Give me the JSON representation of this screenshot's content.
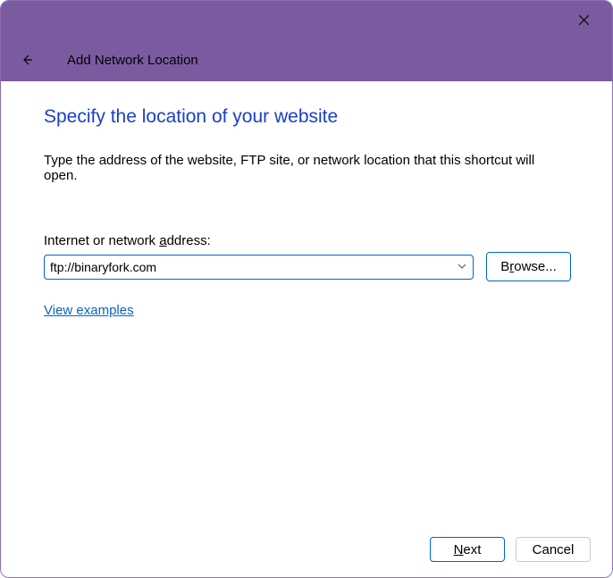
{
  "window": {
    "header_title": "Add Network Location"
  },
  "page": {
    "heading": "Specify the location of your website",
    "description": "Type the address of the website, FTP site, or network location that this shortcut will open.",
    "input_label_prefix": "Internet or network ",
    "input_label_accel": "a",
    "input_label_suffix": "ddress:",
    "address_value": "ftp://binaryfork.com",
    "browse_prefix": "B",
    "browse_accel": "r",
    "browse_suffix": "owse...",
    "examples_text": "View examples"
  },
  "footer": {
    "next_accel": "N",
    "next_suffix": "ext",
    "cancel": "Cancel"
  }
}
